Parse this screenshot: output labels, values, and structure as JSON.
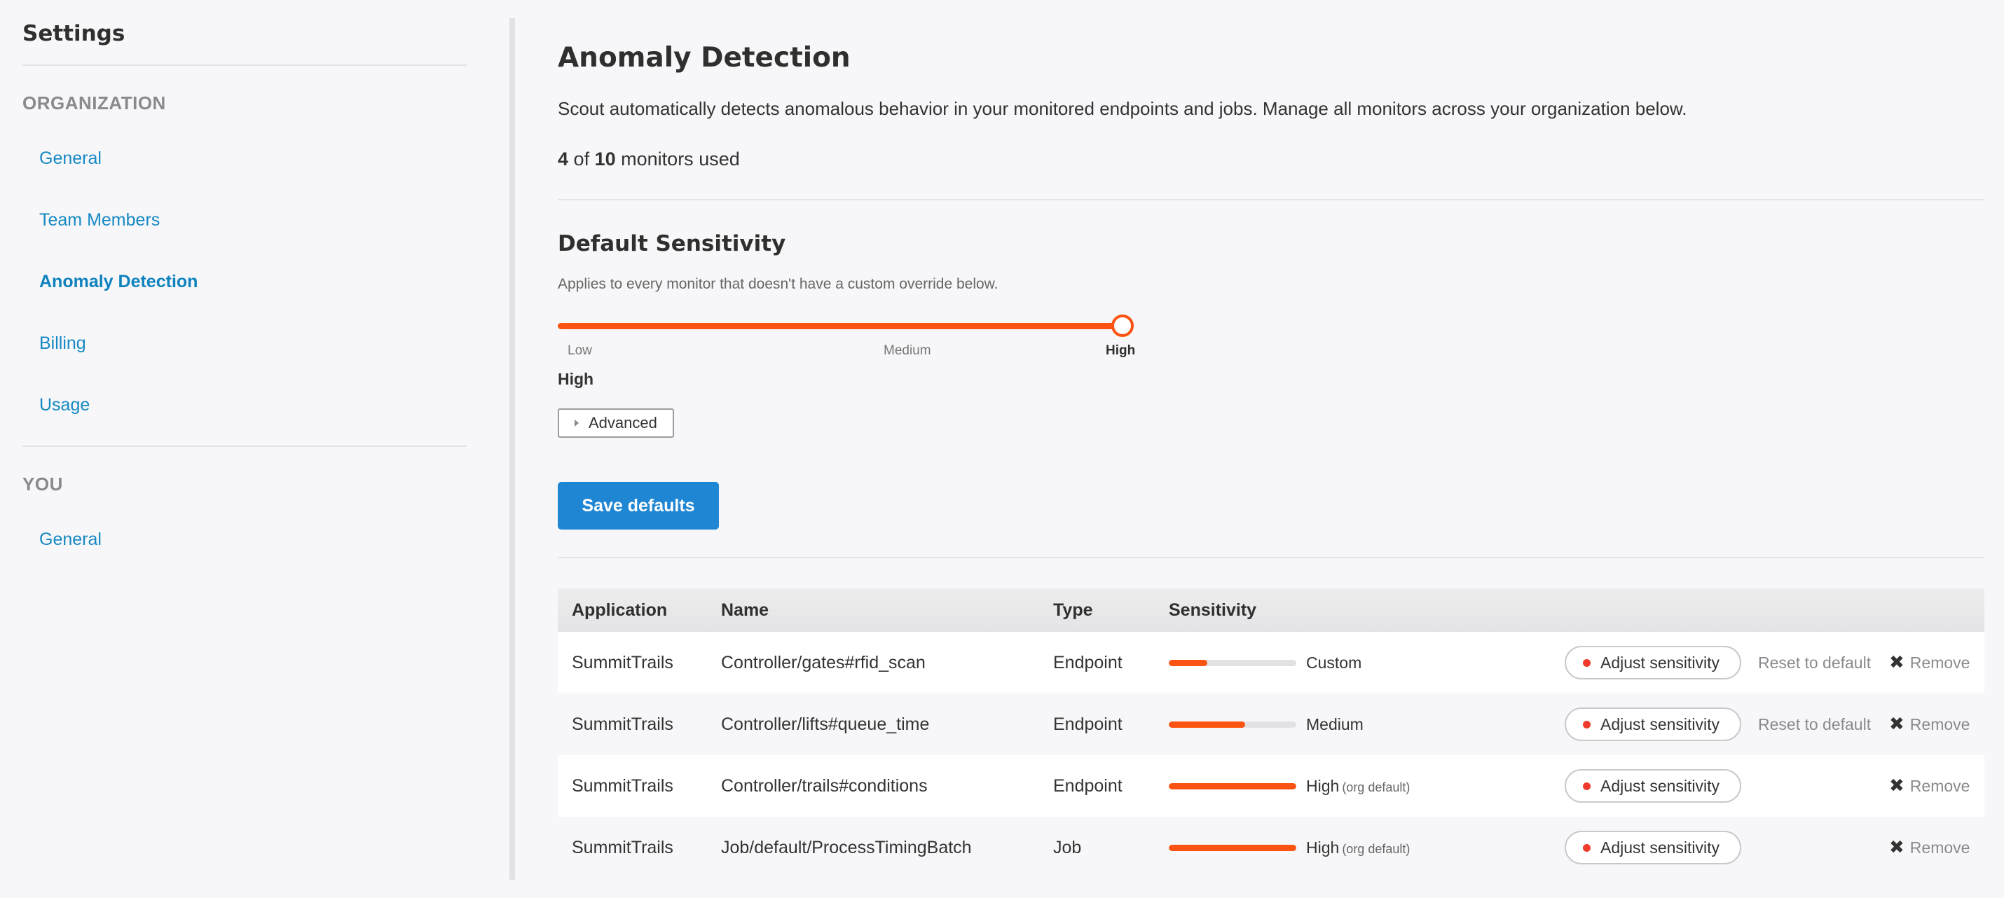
{
  "sidebar": {
    "title": "Settings",
    "org_heading": "ORGANIZATION",
    "org_items": [
      {
        "label": "General"
      },
      {
        "label": "Team Members"
      },
      {
        "label": "Anomaly Detection"
      },
      {
        "label": "Billing"
      },
      {
        "label": "Usage"
      }
    ],
    "you_heading": "YOU",
    "you_items": [
      {
        "label": "General"
      }
    ],
    "active_item": "Anomaly Detection"
  },
  "main": {
    "title": "Anomaly Detection",
    "description": "Scout automatically detects anomalous behavior in your monitored endpoints and jobs. Manage all monitors across your organization below.",
    "usage": {
      "used": "4",
      "of_word": "of",
      "total": "10",
      "suffix": "monitors used"
    }
  },
  "defaults": {
    "title": "Default Sensitivity",
    "description": "Applies to every monitor that doesn't have a custom override below.",
    "slider": {
      "labels": {
        "low": "Low",
        "medium": "Medium",
        "high": "High"
      },
      "value_fraction": 1.0
    },
    "current_level": "High",
    "advanced_label": "Advanced",
    "save_label": "Save defaults"
  },
  "table": {
    "headers": {
      "application": "Application",
      "name": "Name",
      "type": "Type",
      "sensitivity": "Sensitivity"
    },
    "rows": [
      {
        "application": "SummitTrails",
        "name": "Controller/gates#rfid_scan",
        "type": "Endpoint",
        "sensitivity_fraction": 0.3,
        "sensitivity_label": "Custom",
        "sensitivity_note": "",
        "adjust_label": "Adjust sensitivity",
        "reset_label": "Reset to default",
        "remove_label": "Remove"
      },
      {
        "application": "SummitTrails",
        "name": "Controller/lifts#queue_time",
        "type": "Endpoint",
        "sensitivity_fraction": 0.6,
        "sensitivity_label": "Medium",
        "sensitivity_note": "",
        "adjust_label": "Adjust sensitivity",
        "reset_label": "Reset to default",
        "remove_label": "Remove"
      },
      {
        "application": "SummitTrails",
        "name": "Controller/trails#conditions",
        "type": "Endpoint",
        "sensitivity_fraction": 1.0,
        "sensitivity_label": "High",
        "sensitivity_note": "(org default)",
        "adjust_label": "Adjust sensitivity",
        "reset_label": "",
        "remove_label": "Remove"
      },
      {
        "application": "SummitTrails",
        "name": "Job/default/ProcessTimingBatch",
        "type": "Job",
        "sensitivity_fraction": 1.0,
        "sensitivity_label": "High",
        "sensitivity_note": "(org default)",
        "adjust_label": "Adjust sensitivity",
        "reset_label": "",
        "remove_label": "Remove"
      }
    ]
  },
  "colors": {
    "accent": "#1f86d4",
    "link": "#1689c4",
    "slider": "#fb5412",
    "status_dot": "#ee3b2b"
  },
  "icons": {
    "remove": "close-x-icon",
    "advanced": "caret-right-icon",
    "adjust": "status-dot-icon"
  }
}
